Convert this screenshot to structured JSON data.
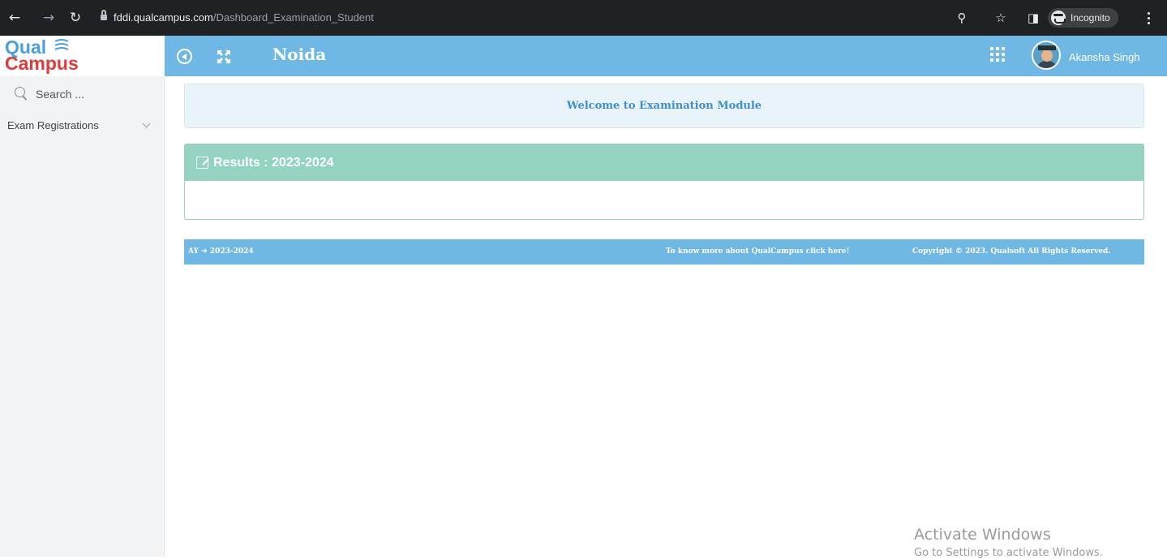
{
  "browser": {
    "url_domain": "fddi.qualcampus.com",
    "url_path": "/Dashboard_Examination_Student",
    "incognito_label": "Incognito",
    "icons": [
      "back-arrow-icon",
      "forward-arrow-icon",
      "reload-icon",
      "lock-icon",
      "zoom-icon",
      "star-icon",
      "side-panel-icon",
      "incognito-icon",
      "kebab-menu-icon"
    ]
  },
  "header": {
    "logo_top": "Qual",
    "logo_bottom": "Campus",
    "campus_name": "Noida",
    "user_name": "Akansha Singh",
    "accent_color": "#6fb8e5"
  },
  "sidebar": {
    "search_placeholder": "Search ...",
    "items": [
      {
        "label": "Exam Registrations"
      }
    ]
  },
  "main": {
    "welcome_text": "Welcome to Examination Module",
    "results_title": "Results : 2023-2024",
    "results_color": "#94d2c1"
  },
  "footer": {
    "ay_prefix": "AY",
    "ay_value": "2023-2024",
    "info_link": "To know more about QualCampus click here!",
    "copyright": "Copyright © 2023. Qualsoft All Rights Reserved."
  },
  "watermark": {
    "title": "Activate Windows",
    "subtitle": "Go to Settings to activate Windows."
  }
}
